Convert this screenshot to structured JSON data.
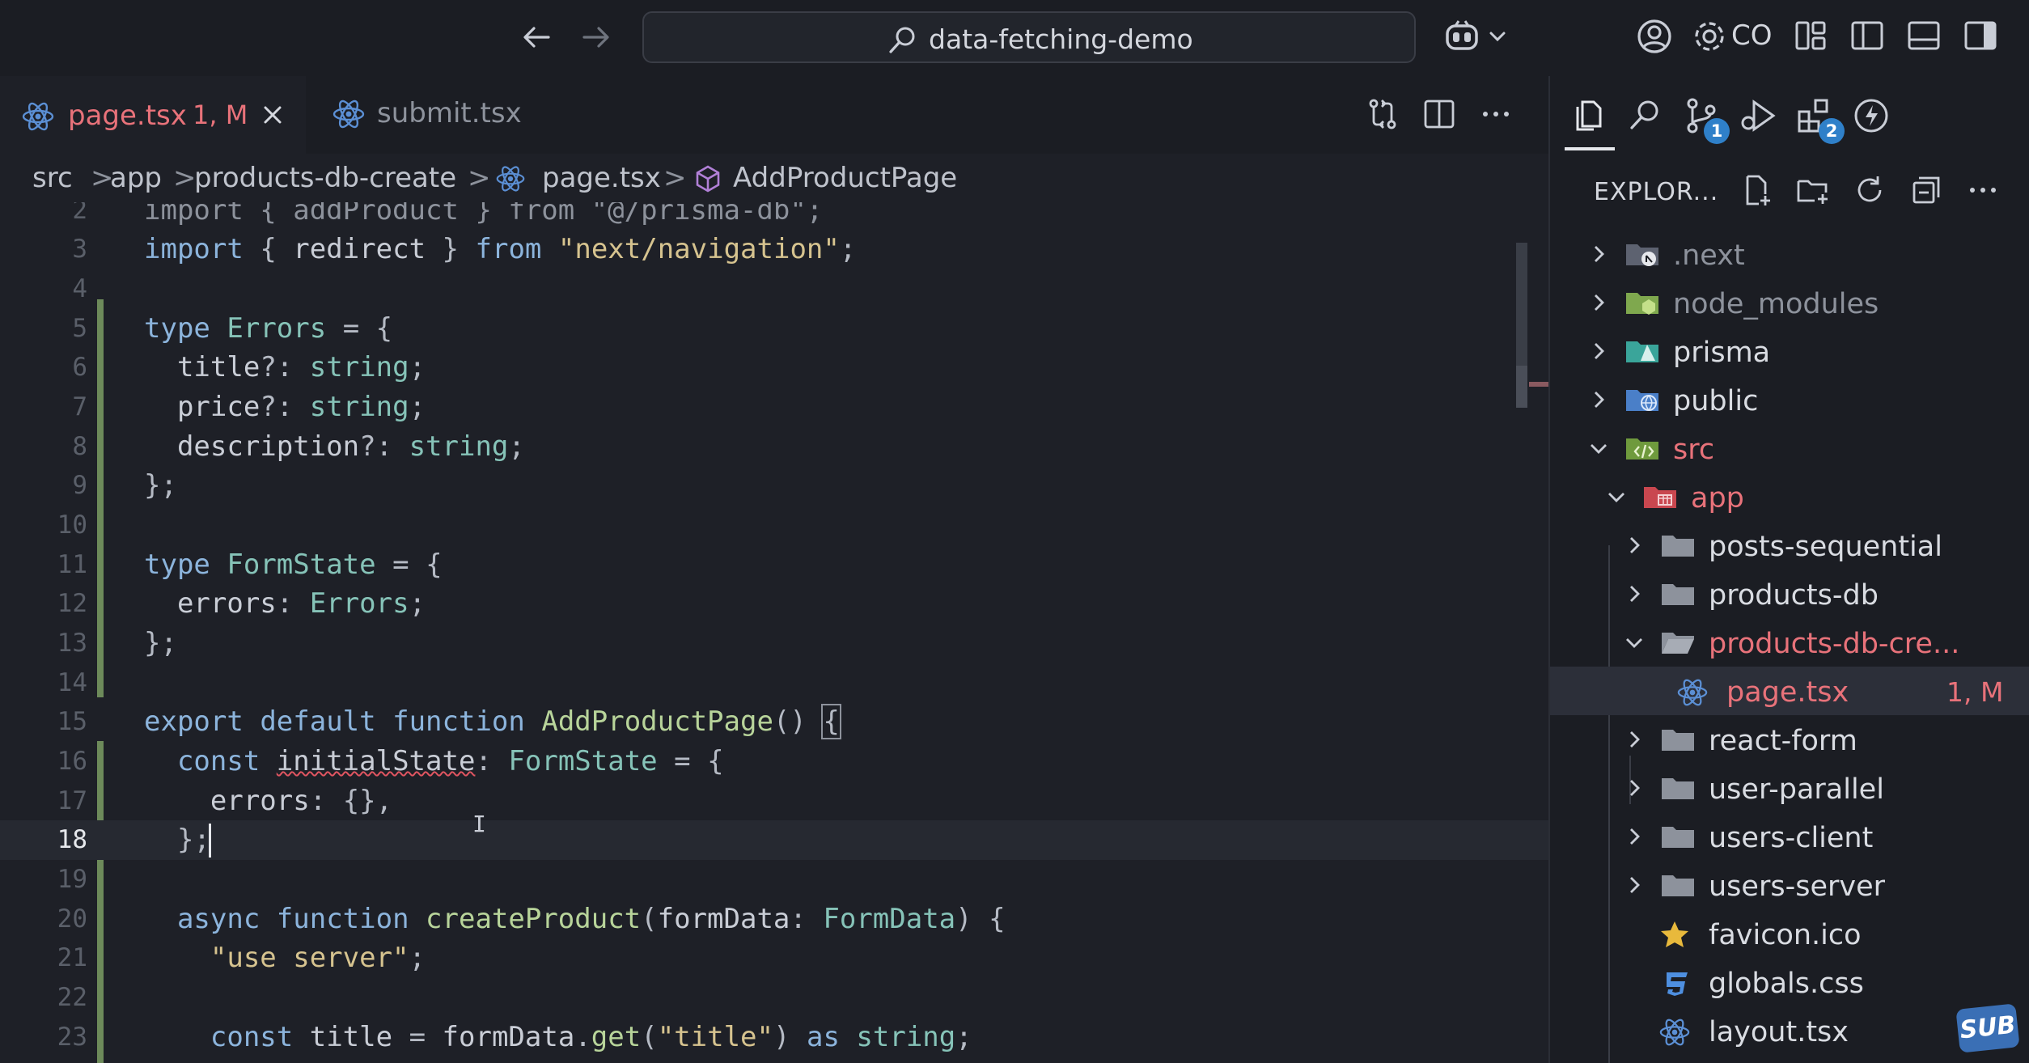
{
  "titlebar": {
    "search_text": "data-fetching-demo",
    "account_text": "CO"
  },
  "tabs": [
    {
      "label": "page.tsx",
      "badge": "1, M",
      "icon": "react-icon",
      "active": true
    },
    {
      "label": "submit.tsx",
      "icon": "react-icon",
      "active": false
    }
  ],
  "breadcrumb": {
    "items": [
      "src",
      "app",
      "products-db-create",
      "page.tsx",
      "AddProductPage"
    ],
    "separator": ">"
  },
  "editor": {
    "line_numbers": [
      "2",
      "3",
      "4",
      "5",
      "6",
      "7",
      "8",
      "9",
      "10",
      "11",
      "12",
      "13",
      "14",
      "15",
      "16",
      "17",
      "18",
      "19",
      "20",
      "21",
      "22",
      "23"
    ],
    "current_line": "18",
    "lines": [
      "import { addProduct } from \"@/prisma-db\";",
      "import { redirect } from \"next/navigation\";",
      "",
      "type Errors = {",
      "  title?: string;",
      "  price?: string;",
      "  description?: string;",
      "};",
      "",
      "type FormState = {",
      "  errors: Errors;",
      "};",
      "",
      "export default function AddProductPage() {",
      "  const initialState: FormState = {",
      "    errors: {},",
      "  };",
      "",
      "  async function createProduct(formData: FormData) {",
      "    \"use server\";",
      "",
      "    const title = formData.get(\"title\") as string;"
    ]
  },
  "explorer": {
    "title": "EXPLOR...",
    "activity_badges": {
      "source_control": "1",
      "extensions": "2"
    },
    "tree": [
      {
        "label": ".next",
        "status": ""
      },
      {
        "label": "node_modules",
        "status": ""
      },
      {
        "label": "prisma",
        "status": ""
      },
      {
        "label": "public",
        "status": ""
      },
      {
        "label": "src",
        "status": ""
      },
      {
        "label": "app",
        "status": ""
      },
      {
        "label": "posts-sequential",
        "status": ""
      },
      {
        "label": "products-db",
        "status": ""
      },
      {
        "label": "products-db-cre...",
        "status": ""
      },
      {
        "label": "page.tsx",
        "status": "1, M"
      },
      {
        "label": "react-form",
        "status": ""
      },
      {
        "label": "user-parallel",
        "status": ""
      },
      {
        "label": "users-client",
        "status": ""
      },
      {
        "label": "users-server",
        "status": ""
      },
      {
        "label": "favicon.ico",
        "status": ""
      },
      {
        "label": "globals.css",
        "status": ""
      },
      {
        "label": "layout.tsx",
        "status": ""
      }
    ]
  },
  "watermark": {
    "text": "SUB"
  },
  "colors": {
    "background": "#1e2027",
    "modified": "#e8727a",
    "keyword": "#8cb4dc",
    "type": "#86c3b8",
    "string": "#d6c38f",
    "function": "#b8d49a",
    "badge": "#2f80c9"
  }
}
